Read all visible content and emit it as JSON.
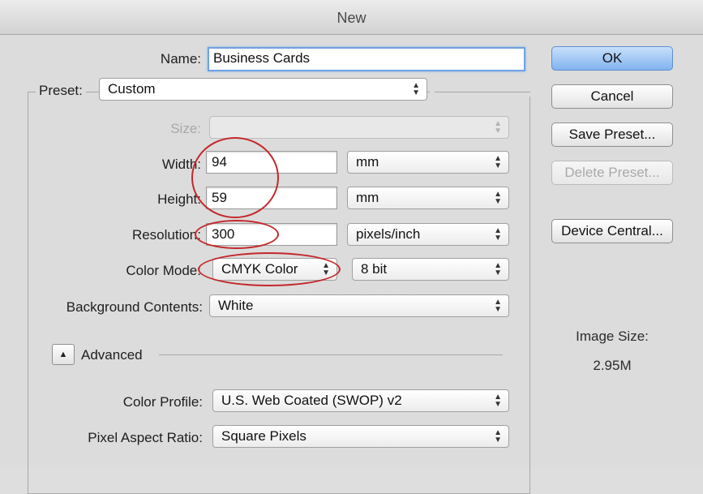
{
  "window": {
    "title": "New"
  },
  "name": {
    "label": "Name:",
    "value": "Business Cards"
  },
  "preset": {
    "label": "Preset:",
    "value": "Custom"
  },
  "size": {
    "label": "Size:",
    "value": ""
  },
  "width": {
    "label": "Width:",
    "value": "94",
    "unit": "mm"
  },
  "height": {
    "label": "Height:",
    "value": "59",
    "unit": "mm"
  },
  "resolution": {
    "label": "Resolution:",
    "value": "300",
    "unit": "pixels/inch"
  },
  "color_mode": {
    "label": "Color Mode:",
    "value": "CMYK Color",
    "depth": "8 bit"
  },
  "background": {
    "label": "Background Contents:",
    "value": "White"
  },
  "advanced": {
    "label": "Advanced"
  },
  "color_profile": {
    "label": "Color Profile:",
    "value": "U.S. Web Coated (SWOP) v2"
  },
  "pixel_aspect": {
    "label": "Pixel Aspect Ratio:",
    "value": "Square Pixels"
  },
  "buttons": {
    "ok": "OK",
    "cancel": "Cancel",
    "save_preset": "Save Preset...",
    "delete_preset": "Delete Preset...",
    "device_central": "Device Central..."
  },
  "image_size": {
    "label": "Image Size:",
    "value": "2.95M"
  },
  "colors": {
    "accent": "#82b3ef",
    "annotation": "#c4282b"
  }
}
